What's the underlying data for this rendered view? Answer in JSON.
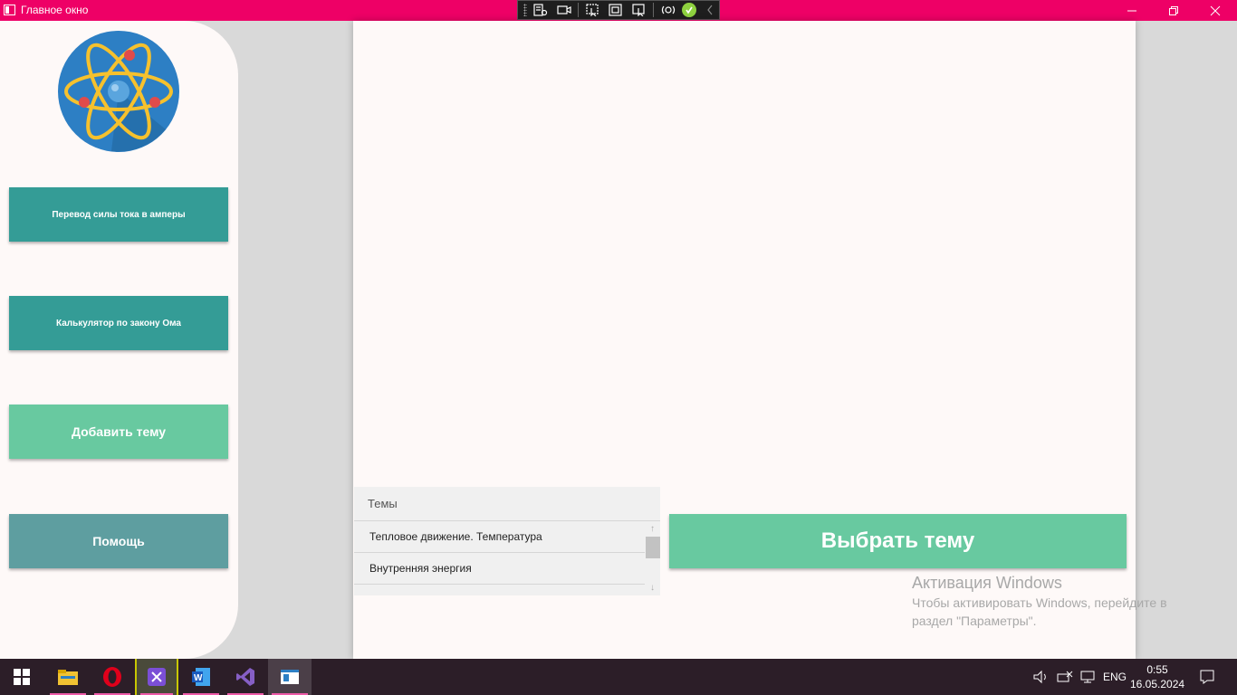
{
  "window": {
    "title": "Главное окно"
  },
  "sidebar": {
    "buttons": [
      {
        "label": "Перевод силы тока в амперы"
      },
      {
        "label": "Калькулятор по закону Ома"
      },
      {
        "label": "Добавить тему"
      },
      {
        "label": "Помощь"
      }
    ]
  },
  "topics": {
    "header": "Темы",
    "items": [
      "Тепловое движение. Температура",
      "Внутренняя энергия"
    ]
  },
  "main": {
    "choose_button": "Выбрать тему"
  },
  "activation": {
    "title": "Активация Windows",
    "line1": "Чтобы активировать Windows, перейдите в",
    "line2": "раздел \"Параметры\"."
  },
  "taskbar": {
    "language": "ENG",
    "time": "0:55",
    "date": "16.05.2024",
    "apps": [
      "start-icon",
      "file-explorer-icon",
      "opera-icon",
      "visual-studio-preview-icon",
      "word-icon",
      "visual-studio-icon",
      "app-window-icon"
    ]
  },
  "colors": {
    "titlebar": "#ee0066",
    "teal_button": "#349c96",
    "green_button": "#68c9a0",
    "slate_button": "#5e9ea0"
  }
}
